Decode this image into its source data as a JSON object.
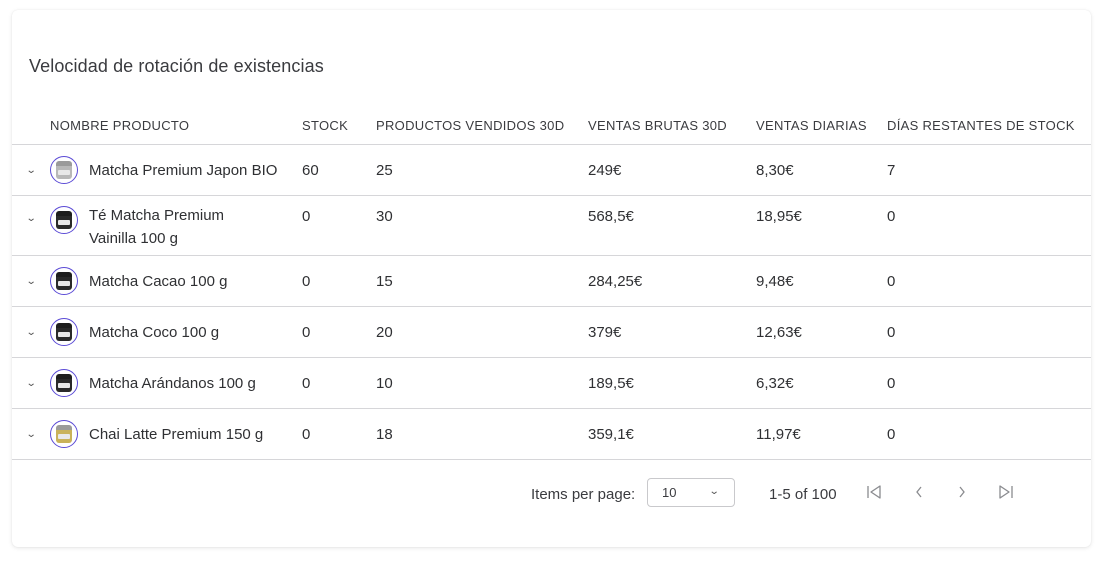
{
  "card": {
    "title": "Velocidad de rotación de existencias"
  },
  "table": {
    "headers": [
      "NOMBRE PRODUCTO",
      "STOCK",
      "PRODUCTOS VENDIDOS 30D",
      "VENTAS BRUTAS 30D",
      "VENTAS DIARIAS",
      "DÍAS RESTANTES DE STOCK"
    ],
    "rows": [
      {
        "name": "Matcha Premium Japon BIO",
        "stock": "60",
        "sold": "25",
        "gross": "249€",
        "daily": "8,30€",
        "days": "7",
        "jar": {
          "lid": "#9a9a9a",
          "body": "#b8b8b8"
        }
      },
      {
        "name": "Té Matcha Premium Vainilla 100 g",
        "stock": "0",
        "sold": "30",
        "gross": "568,5€",
        "daily": "18,95€",
        "days": "0",
        "jar": {
          "lid": "#1e1e1e",
          "body": "#2a2a2a"
        }
      },
      {
        "name": "Matcha Cacao 100 g",
        "stock": "0",
        "sold": "15",
        "gross": "284,25€",
        "daily": "9,48€",
        "days": "0",
        "jar": {
          "lid": "#1e1e1e",
          "body": "#2a2a2a"
        }
      },
      {
        "name": "Matcha Coco 100 g",
        "stock": "0",
        "sold": "20",
        "gross": "379€",
        "daily": "12,63€",
        "days": "0",
        "jar": {
          "lid": "#1e1e1e",
          "body": "#2a2a2a"
        }
      },
      {
        "name": "Matcha Arándanos 100 g",
        "stock": "0",
        "sold": "10",
        "gross": "189,5€",
        "daily": "6,32€",
        "days": "0",
        "jar": {
          "lid": "#1e1e1e",
          "body": "#2a2a2a"
        }
      },
      {
        "name": "Chai Latte Premium 150 g",
        "stock": "0",
        "sold": "18",
        "gross": "359,1€",
        "daily": "11,97€",
        "days": "0",
        "jar": {
          "lid": "#9a9a9a",
          "body": "#c9b25a"
        }
      }
    ]
  },
  "pagination": {
    "items_per_page_label": "Items per page:",
    "items_per_page_value": "10",
    "range_label": "1-5 of 100",
    "icons": [
      "first-page-icon",
      "previous-page-icon",
      "next-page-icon",
      "last-page-icon"
    ]
  },
  "colors": {
    "accent": "#5b4bd6",
    "divider": "#d6d6d9",
    "text": "#2f3033"
  }
}
